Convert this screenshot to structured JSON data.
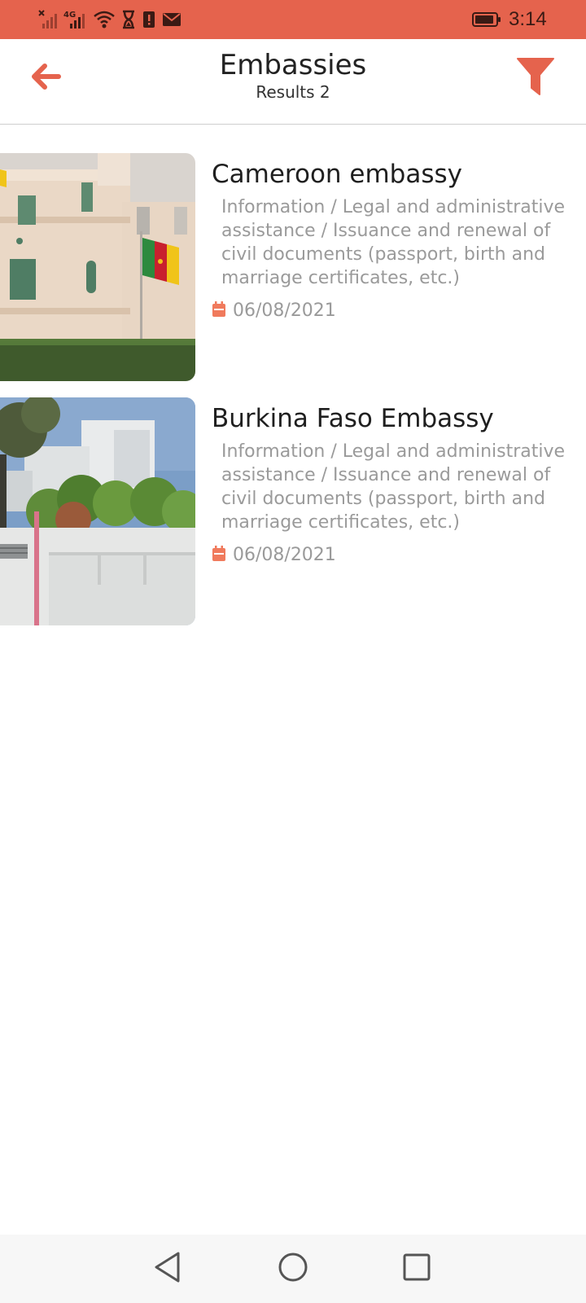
{
  "status_bar": {
    "time": "3:14",
    "network_label": "4G",
    "icons": [
      "signal-x-icon",
      "signal-4g-icon",
      "wifi-icon",
      "hourglass-icon",
      "alert-icon",
      "mail-icon",
      "battery-icon"
    ]
  },
  "header": {
    "title": "Embassies",
    "subtitle": "Results 2",
    "back_icon": "arrow-left-icon",
    "filter_icon": "filter-icon"
  },
  "list": {
    "items": [
      {
        "name": "Cameroon embassy",
        "description": "Information / Legal and administrative assistance / Issuance and renewal of civil documents (passport, birth and marriage certificates, etc.)",
        "date": "06/08/2021",
        "date_icon": "calendar-icon"
      },
      {
        "name": "Burkina Faso Embassy",
        "description": "Information / Legal and administrative assistance / Issuance and renewal of civil documents (passport, birth and marriage certificates, etc.)",
        "date": "06/08/2021",
        "date_icon": "calendar-icon"
      }
    ]
  },
  "nav_bar": {
    "icons": [
      "nav-back-icon",
      "nav-home-icon",
      "nav-recents-icon"
    ]
  },
  "colors": {
    "accent": "#E5634D",
    "status_bar": "#E5634D",
    "title_text": "#222222",
    "secondary_text": "#9A9A9A",
    "calendar_icon": "#F07A5C"
  }
}
